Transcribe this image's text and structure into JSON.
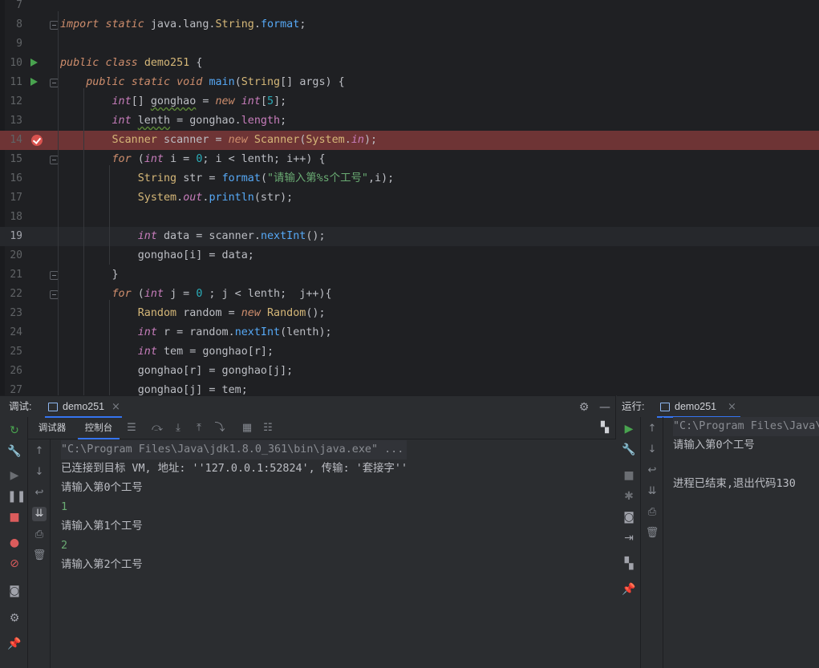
{
  "editor": {
    "lines": [
      {
        "num": "7",
        "segs": []
      },
      {
        "num": "8",
        "segs": [
          [
            "k",
            "import "
          ],
          [
            "k",
            "static "
          ],
          [
            "v",
            "java.lang."
          ],
          [
            "c",
            "String"
          ],
          [
            "v",
            "."
          ],
          [
            "m",
            "format"
          ],
          [
            "v",
            ";"
          ]
        ]
      },
      {
        "num": "9",
        "segs": []
      },
      {
        "num": "10",
        "segs": [
          [
            "k",
            "public "
          ],
          [
            "k",
            "class "
          ],
          [
            "c",
            "demo251 "
          ],
          [
            "v",
            "{"
          ]
        ]
      },
      {
        "num": "11",
        "segs": [
          [
            "v",
            "    "
          ],
          [
            "k",
            "public "
          ],
          [
            "k",
            "static "
          ],
          [
            "k",
            "void "
          ],
          [
            "m",
            "main"
          ],
          [
            "v",
            "("
          ],
          [
            "c",
            "String"
          ],
          [
            "v",
            "[] "
          ],
          [
            "v",
            "args) {"
          ]
        ]
      },
      {
        "num": "12",
        "segs": [
          [
            "v",
            "        "
          ],
          [
            "t",
            "int"
          ],
          [
            "v",
            "[] "
          ],
          [
            "vw",
            "gonghao"
          ],
          [
            "v",
            " = "
          ],
          [
            "k",
            "new "
          ],
          [
            "t",
            "int"
          ],
          [
            "v",
            "["
          ],
          [
            "n",
            "5"
          ],
          [
            "v",
            "];"
          ]
        ]
      },
      {
        "num": "13",
        "segs": [
          [
            "v",
            "        "
          ],
          [
            "t",
            "int "
          ],
          [
            "vw",
            "lenth"
          ],
          [
            "v",
            " = gonghao."
          ],
          [
            "f",
            "length"
          ],
          [
            "v",
            ";"
          ]
        ]
      },
      {
        "num": "14",
        "segs": [
          [
            "v",
            "        "
          ],
          [
            "c",
            "Scanner "
          ],
          [
            "v",
            "scanner = "
          ],
          [
            "k",
            "new "
          ],
          [
            "c",
            "Scanner"
          ],
          [
            "v",
            "("
          ],
          [
            "c",
            "System"
          ],
          [
            "v",
            "."
          ],
          [
            "sf",
            "in"
          ],
          [
            "v",
            ");"
          ]
        ]
      },
      {
        "num": "15",
        "segs": [
          [
            "v",
            "        "
          ],
          [
            "k",
            "for "
          ],
          [
            "v",
            "("
          ],
          [
            "t",
            "int "
          ],
          [
            "v",
            "i = "
          ],
          [
            "n",
            "0"
          ],
          [
            "v",
            "; i < lenth; i++) {"
          ]
        ]
      },
      {
        "num": "16",
        "segs": [
          [
            "v",
            "            "
          ],
          [
            "c",
            "String "
          ],
          [
            "v",
            "str = "
          ],
          [
            "m",
            "format"
          ],
          [
            "v",
            "("
          ],
          [
            "s",
            "\"请输入第%s个工号\""
          ],
          [
            "v",
            ",i);"
          ]
        ]
      },
      {
        "num": "17",
        "segs": [
          [
            "v",
            "            "
          ],
          [
            "c",
            "System"
          ],
          [
            "v",
            "."
          ],
          [
            "sf",
            "out"
          ],
          [
            "v",
            "."
          ],
          [
            "m",
            "println"
          ],
          [
            "v",
            "(str);"
          ]
        ]
      },
      {
        "num": "18",
        "segs": []
      },
      {
        "num": "19",
        "segs": [
          [
            "v",
            "            "
          ],
          [
            "t",
            "int "
          ],
          [
            "v",
            "data = scanner."
          ],
          [
            "m",
            "nextInt"
          ],
          [
            "v",
            "();"
          ]
        ]
      },
      {
        "num": "20",
        "segs": [
          [
            "v",
            "            "
          ],
          [
            "v",
            "gonghao[i] = data;"
          ]
        ]
      },
      {
        "num": "21",
        "segs": [
          [
            "v",
            "        }"
          ]
        ]
      },
      {
        "num": "22",
        "segs": [
          [
            "v",
            "        "
          ],
          [
            "k",
            "for "
          ],
          [
            "v",
            "("
          ],
          [
            "t",
            "int "
          ],
          [
            "v",
            "j = "
          ],
          [
            "n",
            "0"
          ],
          [
            "v",
            " ; j < lenth;  j++){"
          ]
        ]
      },
      {
        "num": "23",
        "segs": [
          [
            "v",
            "            "
          ],
          [
            "c",
            "Random "
          ],
          [
            "v",
            "random = "
          ],
          [
            "k",
            "new "
          ],
          [
            "c",
            "Random"
          ],
          [
            "v",
            "();"
          ]
        ]
      },
      {
        "num": "24",
        "segs": [
          [
            "v",
            "            "
          ],
          [
            "t",
            "int "
          ],
          [
            "v",
            "r = random."
          ],
          [
            "m",
            "nextInt"
          ],
          [
            "v",
            "(lenth);"
          ]
        ]
      },
      {
        "num": "25",
        "segs": [
          [
            "v",
            "            "
          ],
          [
            "t",
            "int "
          ],
          [
            "v",
            "tem = gonghao[r];"
          ]
        ]
      },
      {
        "num": "26",
        "segs": [
          [
            "v",
            "            "
          ],
          [
            "v",
            "gonghao[r] = gonghao[j];"
          ]
        ]
      },
      {
        "num": "27",
        "segs": [
          [
            "v",
            "            "
          ],
          [
            "v",
            "gonghao[j] = tem;"
          ]
        ]
      }
    ]
  },
  "debug": {
    "title": "调试:",
    "tab_label": "demo251",
    "close_glyph": "×",
    "subtabs": [
      "调试器",
      "控制台"
    ],
    "console_lines": [
      {
        "kind": "cmd",
        "text": "\"C:\\Program Files\\Java\\jdk1.8.0_361\\bin\\java.exe\" ..."
      },
      {
        "kind": "out",
        "text": "已连接到目标 VM, 地址: ''127.0.0.1:52824', 传输: '套接字''"
      },
      {
        "kind": "out",
        "text": "请输入第0个工号"
      },
      {
        "kind": "inp",
        "text": "1"
      },
      {
        "kind": "out",
        "text": "请输入第1个工号"
      },
      {
        "kind": "inp",
        "text": "2"
      },
      {
        "kind": "out",
        "text": "请输入第2个工号"
      }
    ]
  },
  "run": {
    "title": "运行:",
    "tab_label": "demo251",
    "close_glyph": "×",
    "console_lines": [
      {
        "kind": "cmd",
        "text": "\"C:\\Program Files\\Java\\"
      },
      {
        "kind": "out",
        "text": "请输入第0个工号"
      },
      {
        "kind": "out",
        "text": ""
      },
      {
        "kind": "out",
        "text": "进程已结束,退出代码130"
      }
    ]
  },
  "colors": {
    "breakpoint_line": "#6e3435",
    "accent": "#3574f0",
    "run_green": "#49a34f",
    "stop_red": "#db5c5c"
  }
}
